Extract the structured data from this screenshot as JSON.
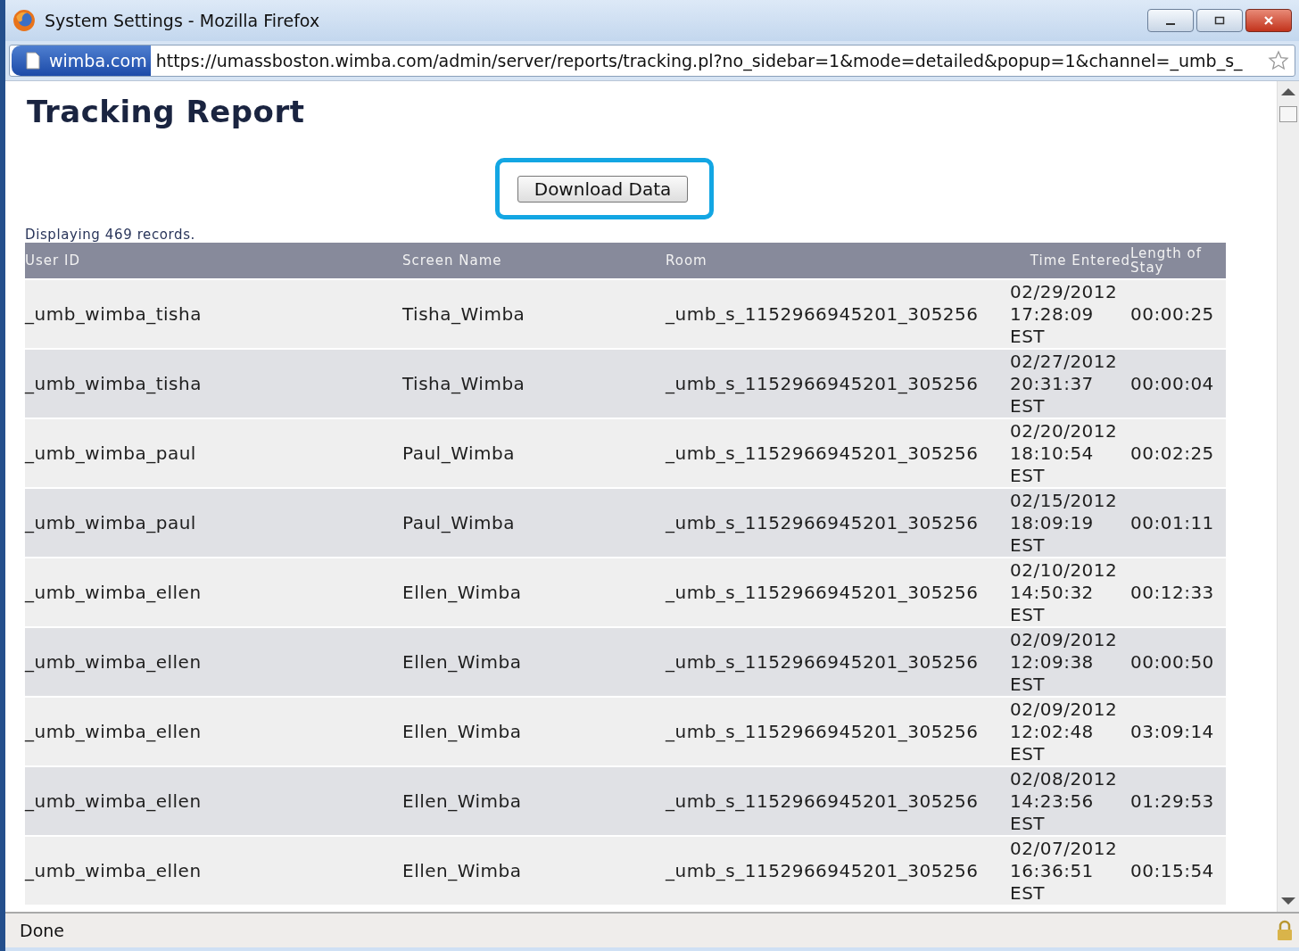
{
  "window": {
    "title": "System Settings - Mozilla Firefox"
  },
  "address_bar": {
    "site": "wimba.com",
    "url": "https://umassboston.wimba.com/admin/server/reports/tracking.pl?no_sidebar=1&mode=detailed&popup=1&channel=_umb_s_"
  },
  "page": {
    "heading": "Tracking Report",
    "download_button": {
      "label": "Download Data",
      "highlighted": true
    },
    "record_count": "Displaying 469 records."
  },
  "table": {
    "columns": [
      "User ID",
      "Screen Name",
      "Room",
      "Time Entered",
      "Length of Stay"
    ],
    "rows": [
      [
        "_umb_wimba_tisha",
        "Tisha_Wimba",
        "_umb_s_1152966945201_305256",
        "02/29/2012 17:28:09 EST",
        "00:00:25"
      ],
      [
        "_umb_wimba_tisha",
        "Tisha_Wimba",
        "_umb_s_1152966945201_305256",
        "02/27/2012 20:31:37 EST",
        "00:00:04"
      ],
      [
        "_umb_wimba_paul",
        "Paul_Wimba",
        "_umb_s_1152966945201_305256",
        "02/20/2012 18:10:54 EST",
        "00:02:25"
      ],
      [
        "_umb_wimba_paul",
        "Paul_Wimba",
        "_umb_s_1152966945201_305256",
        "02/15/2012 18:09:19 EST",
        "00:01:11"
      ],
      [
        "_umb_wimba_ellen",
        "Ellen_Wimba",
        "_umb_s_1152966945201_305256",
        "02/10/2012 14:50:32 EST",
        "00:12:33"
      ],
      [
        "_umb_wimba_ellen",
        "Ellen_Wimba",
        "_umb_s_1152966945201_305256",
        "02/09/2012 12:09:38 EST",
        "00:00:50"
      ],
      [
        "_umb_wimba_ellen",
        "Ellen_Wimba",
        "_umb_s_1152966945201_305256",
        "02/09/2012 12:02:48 EST",
        "03:09:14"
      ],
      [
        "_umb_wimba_ellen",
        "Ellen_Wimba",
        "_umb_s_1152966945201_305256",
        "02/08/2012 14:23:56 EST",
        "01:29:53"
      ],
      [
        "_umb_wimba_ellen",
        "Ellen_Wimba",
        "_umb_s_1152966945201_305256",
        "02/07/2012 16:36:51 EST",
        "00:15:54"
      ]
    ]
  },
  "status_bar": {
    "text": "Done"
  }
}
